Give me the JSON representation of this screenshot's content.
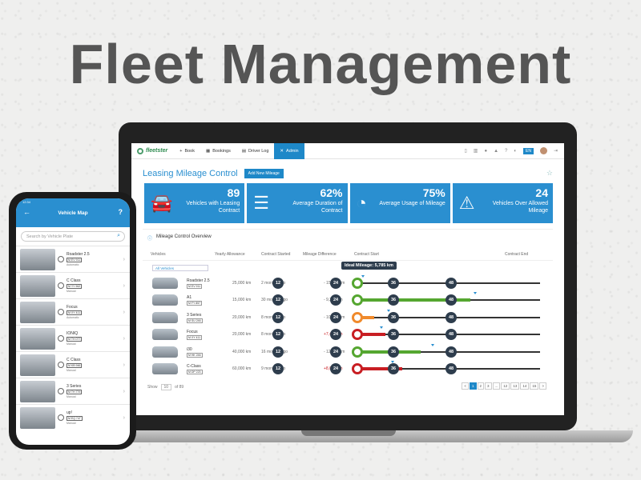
{
  "heading": "Fleet Management",
  "nav": {
    "logo": "fleetster",
    "items": [
      "Book",
      "Bookings",
      "Driver Log",
      "Admin"
    ],
    "lang": "EN"
  },
  "page": {
    "title": "Leasing Mileage Control",
    "add_button": "Add New Mileage"
  },
  "cards": [
    {
      "value": "89",
      "label": "Vehicles with Leasing Contract"
    },
    {
      "value": "62%",
      "label": "Average Duration of Contract"
    },
    {
      "value": "75%",
      "label": "Average Usage of Mileage"
    },
    {
      "value": "24",
      "label": "Vehicles Over Allowed Mileage"
    }
  ],
  "overview": {
    "title": "Mileage Control Overview",
    "columns": [
      "Vehicles",
      "Yearly Allowance",
      "Contract Started",
      "Mileage Difference",
      "Contract Start",
      "Contract End"
    ],
    "filter": "All Vehicles",
    "tooltip": "Ideal Mileage: 5,785 km",
    "markers": [
      "12",
      "24",
      "36",
      "48"
    ],
    "rows": [
      {
        "name": "Roadster 2.5",
        "plate": "M EV 911",
        "allowance": "25,000 km",
        "started": "2 months ago",
        "diff": "- 15,987 km",
        "status": "green",
        "progress": 0,
        "ideal": 0.03
      },
      {
        "name": "A1",
        "plate": "M FY 857",
        "allowance": "15,000 km",
        "started": "30 months ago",
        "diff": "- 9,274 km",
        "status": "green",
        "progress": 0.62,
        "ideal": 0.64
      },
      {
        "name": "3 Series",
        "plate": "M SU 246",
        "allowance": "20,000 km",
        "started": "8 months ago",
        "diff": "- 10,732 km",
        "status": "orange",
        "progress": 0.1,
        "ideal": 0.17
      },
      {
        "name": "Focus",
        "plate": "M XY 411",
        "allowance": "20,000 km",
        "started": "8 months ago",
        "diff": "+7,482 km",
        "status": "red",
        "progress": 0.16,
        "ideal": 0.13
      },
      {
        "name": "i30",
        "plate": "M HK 246",
        "allowance": "40,000 km",
        "started": "16 months ago",
        "diff": "- 12,491 km",
        "status": "green",
        "progress": 0.35,
        "ideal": 0.41
      },
      {
        "name": "C-Class",
        "plate": "M DP 223",
        "allowance": "60,000 km",
        "started": "9 months ago",
        "diff": "+8,073 km",
        "status": "red",
        "progress": 0.25,
        "ideal": 0.19
      }
    ]
  },
  "footer": {
    "show": "Show",
    "per_page": "10",
    "of": "of 89",
    "pages": [
      "<",
      "1",
      "2",
      "3",
      "...",
      "12",
      "13",
      "14",
      "15",
      ">"
    ]
  },
  "phone": {
    "time": "12:34",
    "title": "Vehicle Map",
    "search_placeholder": "Search by Vehicle Plate",
    "items": [
      {
        "name": "Roadster 2.5",
        "plate": "M EV 911",
        "trans": "Automatic"
      },
      {
        "name": "C Class",
        "plate": "M YY 962",
        "trans": "Manual"
      },
      {
        "name": "Focus",
        "plate": "M XY 411",
        "trans": "Automatic"
      },
      {
        "name": "IONIQ",
        "plate": "M TH 077",
        "trans": "Manual"
      },
      {
        "name": "C Class",
        "plate": "M KB 946",
        "trans": "Manual"
      },
      {
        "name": "3 Series",
        "plate": "M TH 779",
        "trans": "Manual"
      },
      {
        "name": "up!",
        "plate": "M EQ 747",
        "trans": "Manual"
      }
    ]
  },
  "colors": {
    "brand": "#2a8fd0",
    "green": "#55a630",
    "orange": "#f08a2c",
    "red": "#c81e23",
    "dark": "#2e3d4d"
  }
}
